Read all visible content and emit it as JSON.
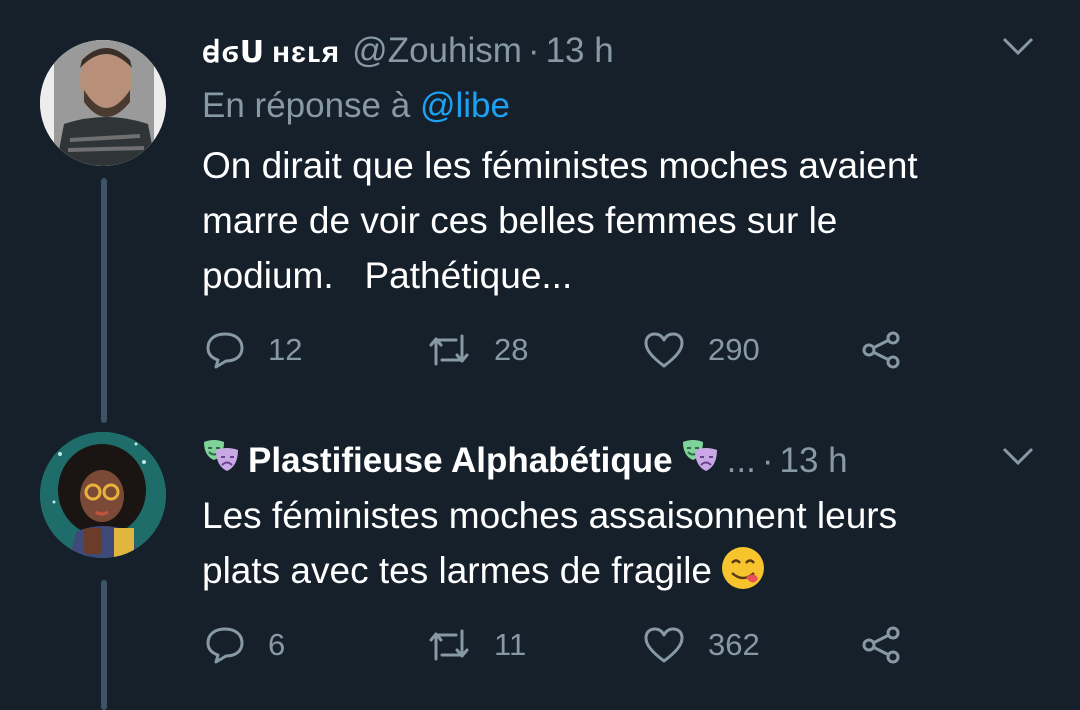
{
  "tweets": [
    {
      "display_name": "ꟈϭՍ ʜɛʟя",
      "handle": "@Zouhism",
      "separator": "·",
      "time": "13 h",
      "reply_prefix": "En réponse à",
      "reply_mention": "@libe",
      "text": "On dirait que les féministes moches avaient\nmarre de voir ces belles femmes sur le\npodium.   Pathétique...",
      "replies": "12",
      "retweets": "28",
      "likes": "290"
    },
    {
      "display_name": "Plastifieuse Alphabétique",
      "name_emoji": "performing-arts-emoji",
      "ellipsis": "...",
      "separator": "·",
      "time": "13 h",
      "text": "Les féministes moches assaisonnent leurs\nplats avec tes larmes de fragile",
      "trailing_emoji": "face-savoring-food-emoji",
      "replies": "6",
      "retweets": "11",
      "likes": "362"
    }
  ],
  "colors": {
    "background": "#15202b",
    "secondary_text": "#8899a6",
    "accent": "#1da1f2",
    "thread_line": "#3d5466"
  },
  "icons": {
    "reply": "reply-icon",
    "retweet": "retweet-icon",
    "like": "heart-icon",
    "share": "share-icon",
    "menu": "chevron-down-icon"
  }
}
